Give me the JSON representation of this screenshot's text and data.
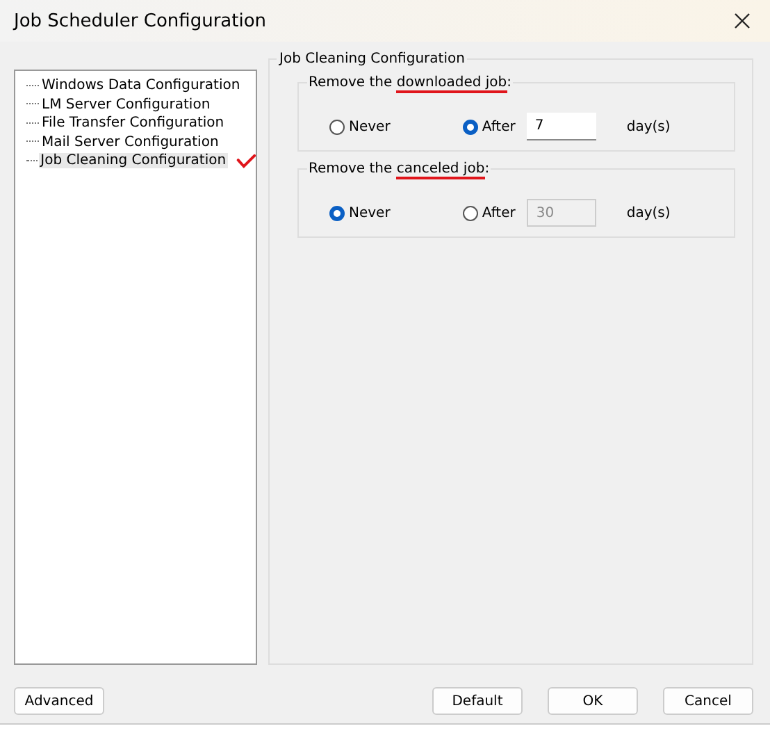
{
  "window": {
    "title": "Job Scheduler Configuration"
  },
  "tree": {
    "items": [
      {
        "label": "Windows Data Configuration",
        "selected": false,
        "marked": false
      },
      {
        "label": "LM Server Configuration",
        "selected": false,
        "marked": false
      },
      {
        "label": "File Transfer Configuration",
        "selected": false,
        "marked": false
      },
      {
        "label": "Mail Server Configuration",
        "selected": false,
        "marked": false
      },
      {
        "label": "Job Cleaning Configuration",
        "selected": true,
        "marked": true
      }
    ]
  },
  "panel": {
    "title": "Job Cleaning Configuration",
    "groups": [
      {
        "label_before": "Remove the ",
        "label_highlight": "downloaded job",
        "label_after": ":",
        "options": [
          {
            "label": "Never",
            "selected": false
          },
          {
            "label": "After",
            "selected": true
          }
        ],
        "days": {
          "value": "7",
          "disabled": false
        },
        "unit": "day(s)"
      },
      {
        "label_before": "Remove the ",
        "label_highlight": "canceled job",
        "label_after": ":",
        "options": [
          {
            "label": "Never",
            "selected": true
          },
          {
            "label": "After",
            "selected": false
          }
        ],
        "days": {
          "value": "30",
          "disabled": true
        },
        "unit": "day(s)"
      }
    ]
  },
  "buttons_left": [
    "Advanced"
  ],
  "buttons_right": [
    "Default",
    "OK",
    "Cancel"
  ]
}
